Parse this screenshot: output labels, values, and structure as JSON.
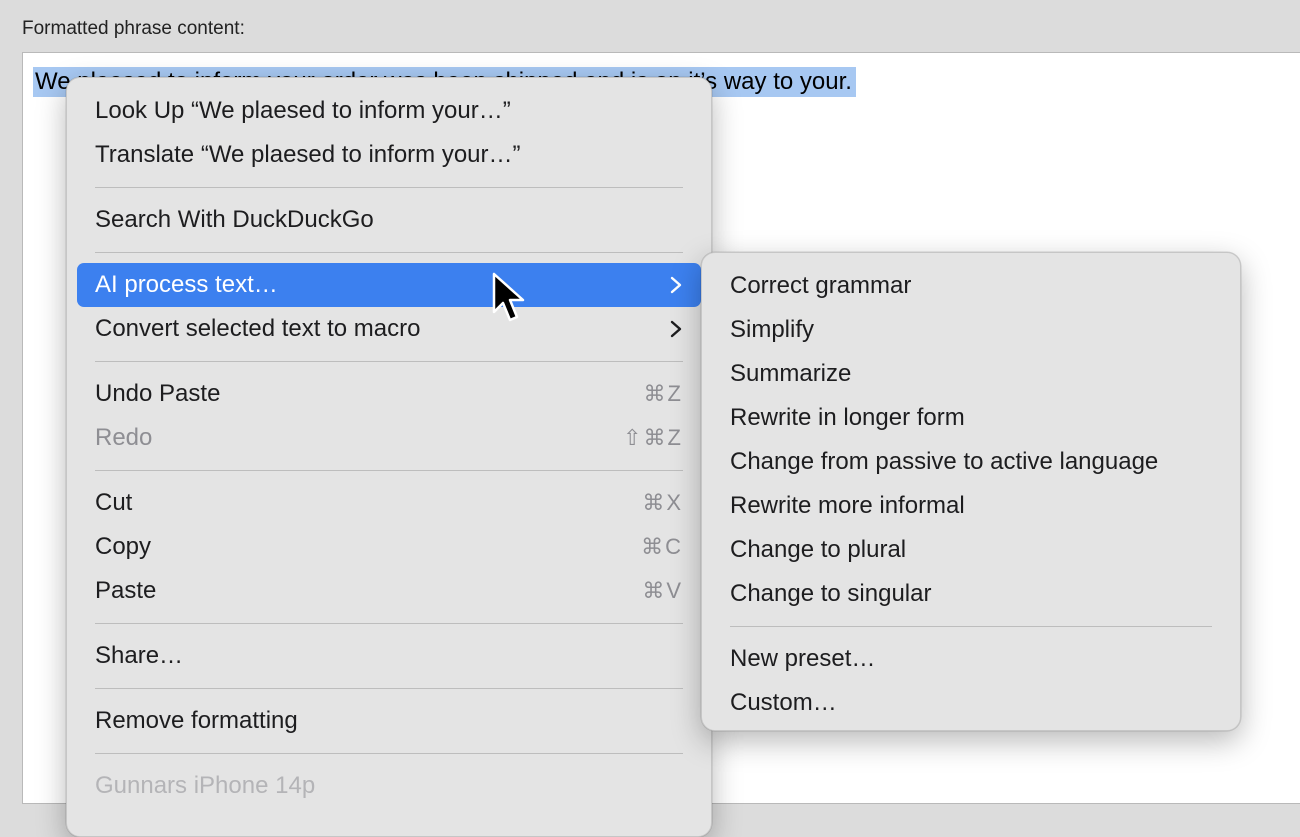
{
  "field_label": "Formatted phrase content:",
  "editor": {
    "selected_text": "We plaesed to inform your order was been shipped and is on it’s way to your."
  },
  "context_menu": {
    "look_up": "Look Up “We plaesed to inform your…”",
    "translate": "Translate “We plaesed to inform your…”",
    "search_with": "Search With DuckDuckGo",
    "ai_process": "AI process text…",
    "convert_macro": "Convert selected text to macro",
    "undo_paste": "Undo Paste",
    "undo_shortcut": "⌘Z",
    "redo": "Redo",
    "redo_shortcut": "⇧⌘Z",
    "cut": "Cut",
    "cut_shortcut": "⌘X",
    "copy": "Copy",
    "copy_shortcut": "⌘C",
    "paste": "Paste",
    "paste_shortcut": "⌘V",
    "share": "Share…",
    "remove_formatting": "Remove formatting",
    "device": "Gunnars iPhone 14p"
  },
  "submenu": {
    "items": [
      "Correct grammar",
      "Simplify",
      "Summarize",
      "Rewrite in longer form",
      "Change from passive to active language",
      "Rewrite more informal",
      "Change to plural",
      "Change to singular"
    ],
    "new_preset": "New preset…",
    "custom": "Custom…"
  },
  "colors": {
    "highlight": "#3c80ef",
    "selection": "#a7c8f2",
    "menu_bg": "#e4e4e4"
  },
  "icons": [
    "chevron-right-icon",
    "arrow-cursor-icon"
  ]
}
